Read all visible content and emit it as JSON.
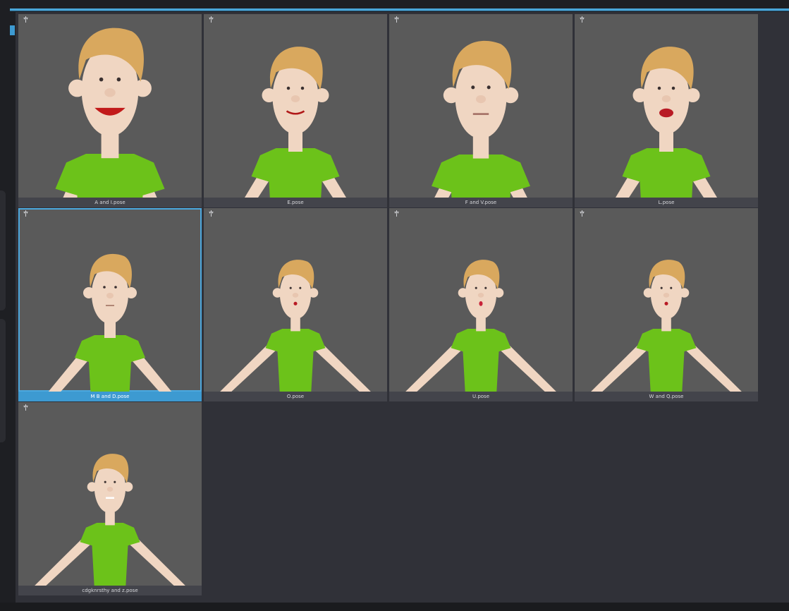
{
  "poses": [
    {
      "label": "A and I.pose",
      "shot": "close",
      "expression": "wide-open-smile",
      "selected": false
    },
    {
      "label": "E.pose",
      "shot": "medium",
      "expression": "narrow-smile",
      "selected": false
    },
    {
      "label": "F and V.pose",
      "shot": "medium-close",
      "expression": "bite-lip",
      "selected": false
    },
    {
      "label": "L.pose",
      "shot": "medium",
      "expression": "open-tongue",
      "selected": false
    },
    {
      "label": "M B and D.pose",
      "shot": "wide",
      "expression": "closed",
      "selected": true
    },
    {
      "label": "O.pose",
      "shot": "full",
      "expression": "small-o",
      "selected": false
    },
    {
      "label": "U.pose",
      "shot": "full",
      "expression": "pucker",
      "selected": false
    },
    {
      "label": "W and Q.pose",
      "shot": "full",
      "expression": "small-o",
      "selected": false
    },
    {
      "label": "cdgknrsthy and z.pose",
      "shot": "full",
      "expression": "teeth",
      "selected": false
    }
  ],
  "icons": {
    "pin": "pin-icon"
  },
  "colors": {
    "accent": "#3d9ad1",
    "thumbnail_bg": "#5a5a5a",
    "panel_bg": "#303138",
    "label_bg": "#43444b",
    "skin": "#f0d6c2",
    "hair": "#d9a85e",
    "shirt": "#6cc21a",
    "pants": "#b21d2c"
  }
}
